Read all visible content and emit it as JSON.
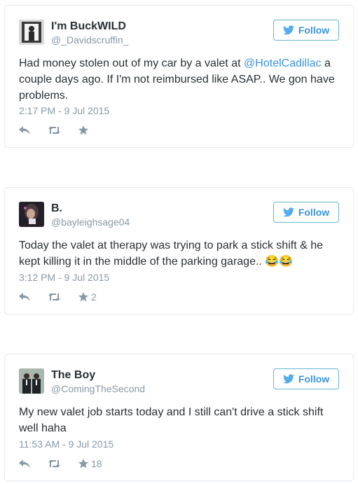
{
  "colors": {
    "link": "#3b94d9",
    "muted": "#8899a6",
    "text": "#292f33",
    "border": "#e1e8ed"
  },
  "tweets": [
    {
      "name": "I'm BuckWILD",
      "handle": "@_Davidscruffin_",
      "follow_label": "Follow",
      "text_before": "Had money stolen out of my car by a valet at ",
      "mention": "@HotelCadillac",
      "text_after": " a couple days ago. If I'm not reimbursed like ASAP.. We gon have problems.",
      "timestamp": "2:17 PM - 9 Jul 2015",
      "favorites": ""
    },
    {
      "name": "B.",
      "handle": "@bayleighsage04",
      "follow_label": "Follow",
      "text": "Today the valet at therapy was trying to park a stick shift & he kept killing it in the middle of the parking garage.. 😂😂",
      "timestamp": "3:12 PM - 9 Jul 2015",
      "favorites": "2"
    },
    {
      "name": "The Boy",
      "handle": "@ComingTheSecond",
      "follow_label": "Follow",
      "text": "My new valet job starts today and I still can't drive a stick shift well haha",
      "timestamp": "11:53 AM - 9 Jul 2015",
      "favorites": "18"
    }
  ],
  "icons": [
    "reply-icon",
    "retweet-icon",
    "favorite-icon",
    "twitter-bird-icon"
  ]
}
